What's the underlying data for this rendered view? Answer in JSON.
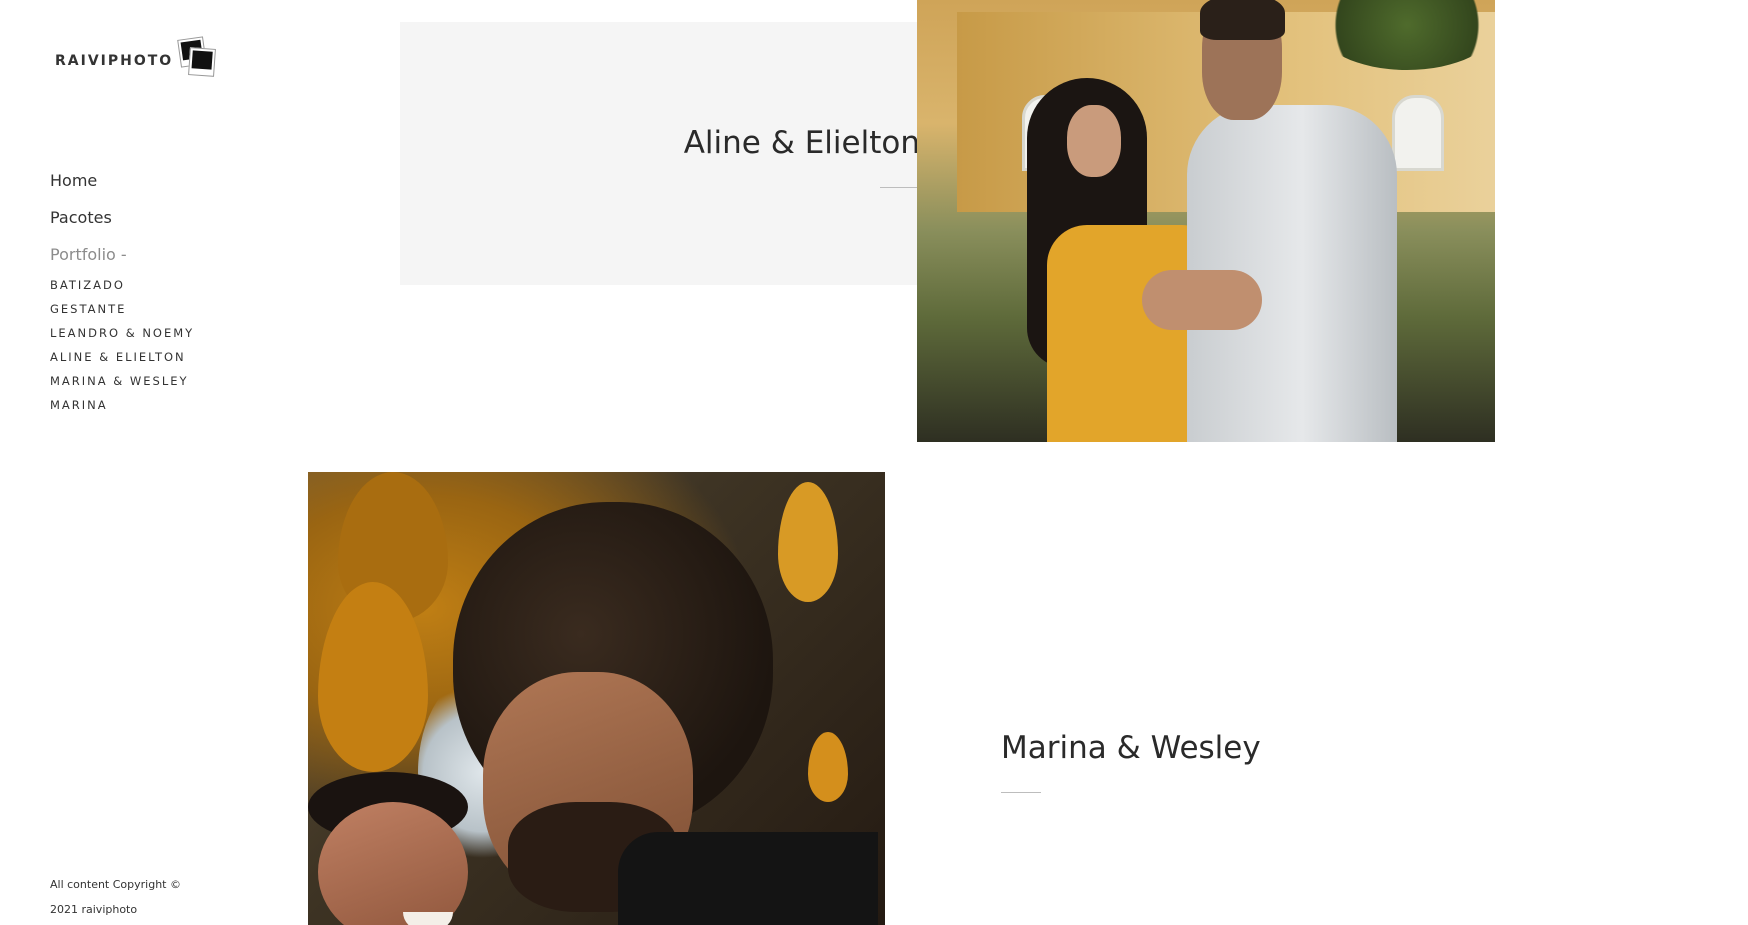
{
  "site": {
    "logo_text": "RAIVIPHOTO",
    "logo_icon": "polaroid-stack-icon"
  },
  "nav": {
    "items": [
      {
        "label": "Home"
      },
      {
        "label": "Pacotes"
      },
      {
        "label": "Portfolio -"
      }
    ],
    "portfolio_sub": [
      {
        "label": "BATIZADO"
      },
      {
        "label": "GESTANTE"
      },
      {
        "label": "LEANDRO & NOEMY"
      },
      {
        "label": "ALINE & ELIELTON"
      },
      {
        "label": "MARINA & WESLEY"
      },
      {
        "label": "MARINA"
      }
    ]
  },
  "footer": {
    "copyright_line1": "All content Copyright ©",
    "copyright_line2": "2021 raiviphoto"
  },
  "gallery": [
    {
      "title": "Aline & Elielton"
    },
    {
      "title": "Marina & Wesley"
    }
  ],
  "colors": {
    "panel_bg": "#f5f5f5",
    "text": "#2a2a2a",
    "muted_nav": "#8c8c8c",
    "divider": "#bdbdbd"
  }
}
